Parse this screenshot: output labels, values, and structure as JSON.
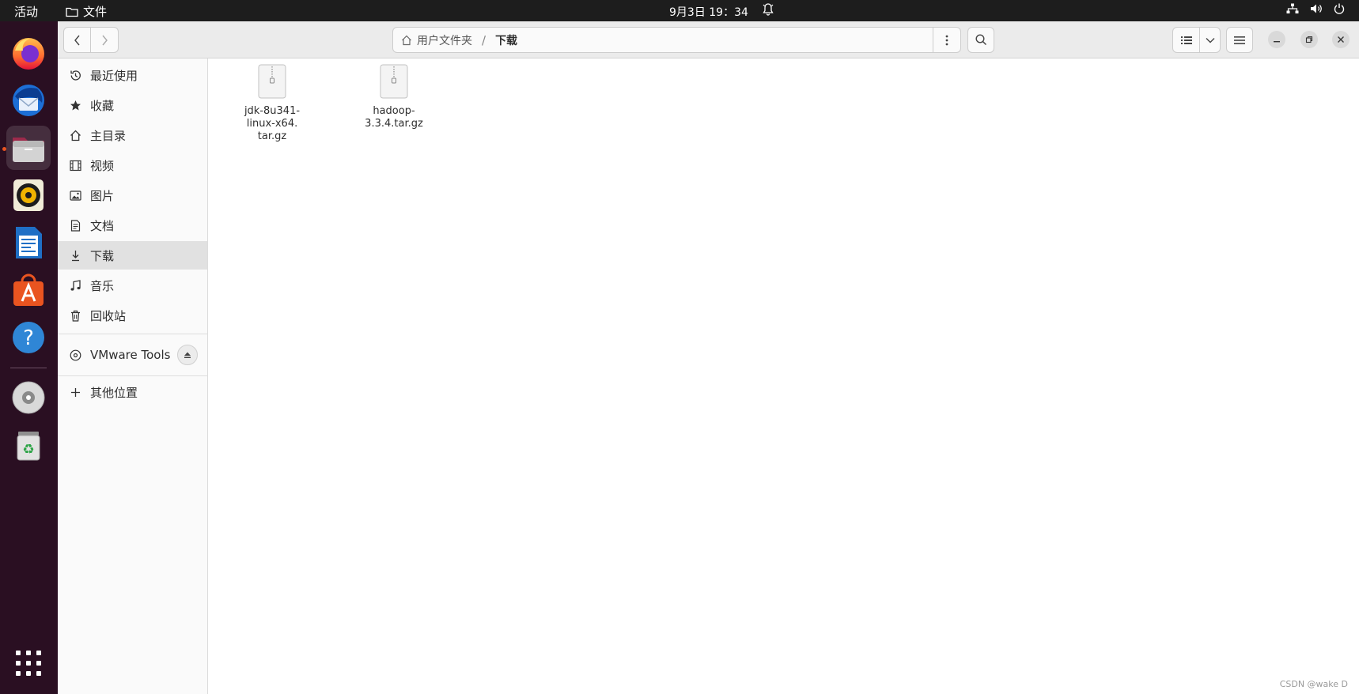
{
  "topbar": {
    "activities_label": "活动",
    "app_name": "文件",
    "clock": "9月3日  19：34"
  },
  "window": {
    "path": {
      "home_label": "用户文件夹",
      "separator": "/",
      "current": "下载"
    }
  },
  "sidebar": {
    "items": [
      {
        "label": "最近使用",
        "icon": "clock-icon"
      },
      {
        "label": "收藏",
        "icon": "star-icon"
      },
      {
        "label": "主目录",
        "icon": "home-icon"
      },
      {
        "label": "视频",
        "icon": "film-icon"
      },
      {
        "label": "图片",
        "icon": "image-icon"
      },
      {
        "label": "文档",
        "icon": "document-icon"
      },
      {
        "label": "下载",
        "icon": "download-icon",
        "selected": true
      },
      {
        "label": "音乐",
        "icon": "music-icon"
      },
      {
        "label": "回收站",
        "icon": "trash-icon"
      }
    ],
    "devices": [
      {
        "label": "VMware Tools",
        "icon": "disc-icon"
      }
    ],
    "other_locations": {
      "label": "其他位置",
      "icon": "plus-icon"
    }
  },
  "files": [
    {
      "name": "jdk-8u341-linux-x64.tar.gz",
      "display_lines": [
        "jdk-8u341-",
        "linux-x64.",
        "tar.gz"
      ],
      "icon": "archive-icon"
    },
    {
      "name": "hadoop-3.3.4.tar.gz",
      "display_lines": [
        "hadoop-",
        "3.3.4.tar.gz"
      ],
      "icon": "archive-icon"
    }
  ],
  "watermark": "CSDN @wake D",
  "colors": {
    "dock_bg": "#2a0f22",
    "topbar_bg": "#1d1d1d",
    "accent": "#e95420"
  }
}
